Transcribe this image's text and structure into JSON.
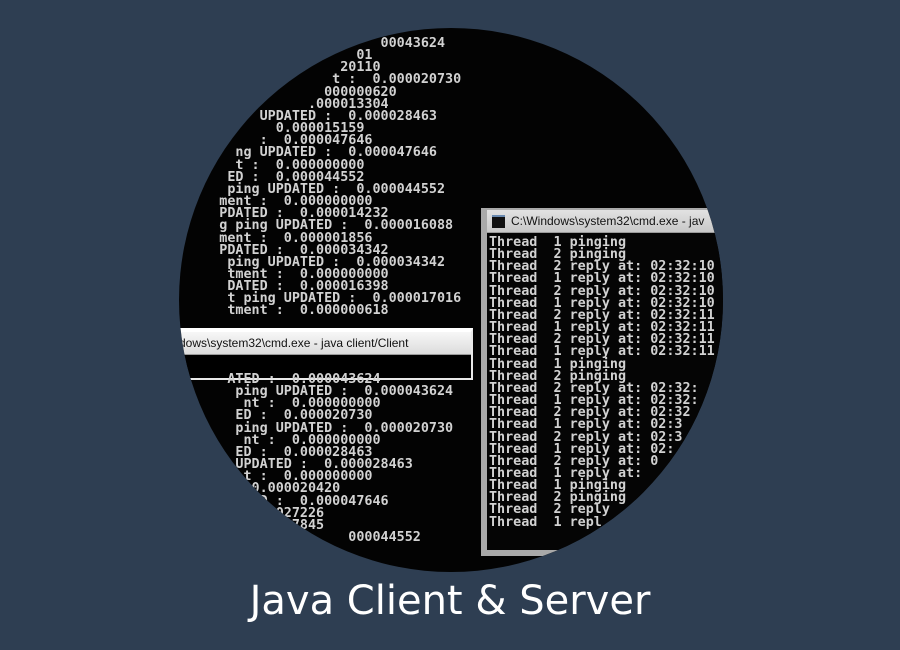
{
  "slide_title": "Java Client & Server",
  "client_window": {
    "title": "dows\\system32\\cmd.exe - java  client/Client",
    "icon": "cmd-icon"
  },
  "server_window": {
    "title": "C:\\Windows\\system32\\cmd.exe - jav",
    "icon": "cmd-icon"
  },
  "client_log_top": [
    "                         00043624",
    "                      01",
    "                    20110",
    "                   t :  0.000020730",
    "                  000000620",
    "                .000013304",
    "          UPDATED :  0.000028463",
    "            0.000015159",
    "          :  0.000047646",
    "       ng UPDATED :  0.000047646",
    "       t :  0.000000000",
    "      ED :  0.000044552",
    "      ping UPDATED :  0.000044552",
    "     ment :  0.000000000",
    "     PDATED :  0.000014232",
    "     g ping UPDATED :  0.000016088",
    "     ment :  0.000001856",
    "     PDATED :  0.000034342",
    "      ping UPDATED :  0.000034342",
    "      tment :  0.000000000",
    "      DATED :  0.000016398",
    "      t ping UPDATED :  0.000017016",
    "      tment :  0.000000618"
  ],
  "client_log_bottom": [
    "      ATED :  0.000043624",
    "       ping UPDATED :  0.000043624",
    "        nt :  0.000000000",
    "       ED :  0.000020730",
    "       ping UPDATED :  0.000020730",
    "        nt :  0.000000000",
    "       ED :  0.000028463",
    "       UPDATED :  0.000028463",
    "        t :  0.000000000",
    "         0.000020420",
    "          D :  0.000047646",
    "            027226",
    "            027845",
    "                     000044552"
  ],
  "server_log": [
    "Thread  1 pinging",
    "Thread  2 pinging",
    "Thread  2 reply at: 02:32:10",
    "Thread  1 reply at: 02:32:10",
    "Thread  2 reply at: 02:32:10",
    "Thread  1 reply at: 02:32:10",
    "Thread  2 reply at: 02:32:11",
    "Thread  1 reply at: 02:32:11",
    "Thread  2 reply at: 02:32:11",
    "Thread  1 reply at: 02:32:11",
    "Thread  1 pinging",
    "Thread  2 pinging",
    "Thread  2 reply at: 02:32:",
    "Thread  1 reply at: 02:32:",
    "Thread  2 reply at: 02:32",
    "Thread  1 reply at: 02:3",
    "Thread  2 reply at: 02:3",
    "Thread  1 reply at: 02:",
    "Thread  2 reply at: 0",
    "Thread  1 reply at:",
    "Thread  1 pinging",
    "Thread  2 pinging",
    "Thread  2 reply",
    "Thread  1 repl"
  ]
}
